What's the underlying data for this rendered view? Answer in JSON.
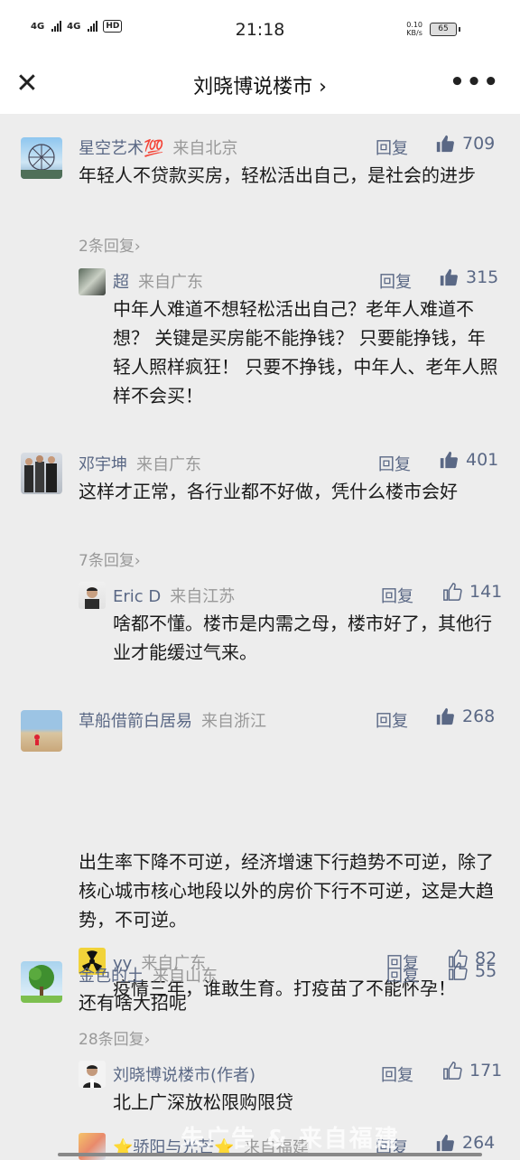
{
  "status_bar": {
    "net1": "4G",
    "net2": "4G",
    "hd": "HD",
    "time": "21:18",
    "speed_value": "0.10",
    "speed_unit": "KB/s",
    "battery": "65"
  },
  "nav": {
    "close_icon": "close-icon",
    "title": "刘晓博说楼市 ›",
    "more_icon": "more-icon"
  },
  "labels": {
    "reply": "回复"
  },
  "comments": [
    {
      "name": "星空艺术💯",
      "location": "来自北京",
      "likes": "709",
      "liked": true,
      "text": "年轻人不贷款买房，轻松活出自己，是社会的进步",
      "more_replies": "2条回复›",
      "reply": {
        "name": "超",
        "location": "来自广东",
        "likes": "315",
        "liked": true,
        "text": "中年人难道不想轻松活出自己？老年人难道不想？ 关键是买房能不能挣钱？ 只要能挣钱，年轻人照样疯狂！ 只要不挣钱，中年人、老年人照样不会买！"
      }
    },
    {
      "name": "邓宇坤",
      "location": "来自广东",
      "likes": "401",
      "liked": true,
      "text": "这样才正常，各行业都不好做，凭什么楼市会好",
      "more_replies": "7条回复›",
      "reply": {
        "name": "Eric D",
        "location": "来自江苏",
        "likes": "141",
        "liked": false,
        "text": "啥都不懂。楼市是内需之母，楼市好了，其他行业才能缓过气来。"
      }
    },
    {
      "name": "草船借箭白居易",
      "location": "来自浙江",
      "likes": "268",
      "liked": true,
      "text": "出生率下降不可逆，经济增速下行趋势不可逆，除了核心城市核心地段以外的房价下行不可逆，这是大趋势，不可逆。",
      "reply": {
        "name": "yy",
        "location": "来自广东",
        "likes": "82",
        "liked": false,
        "text": "疫情三年，谁敢生育。打疫苗了不能怀孕！"
      }
    },
    {
      "name": "金色的土",
      "location": "来自山东",
      "likes": "55",
      "liked": false,
      "text": "还有啥大招呢",
      "more_replies": "28条回复›",
      "reply": {
        "name": "刘晓博说楼市(作者)",
        "location": "",
        "likes": "171",
        "liked": false,
        "text": "北上广深放松限购限贷"
      }
    },
    {
      "name": "⭐骄阳与光芒⭐",
      "location": "来自福建",
      "likes": "264",
      "liked": true,
      "text": ""
    }
  ],
  "watermark": "朱广告 & 来自福建"
}
